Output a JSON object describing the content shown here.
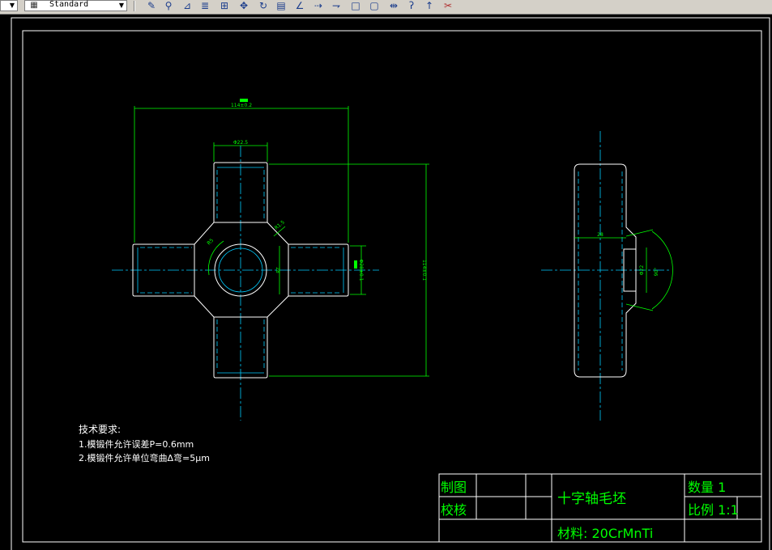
{
  "toolbar": {
    "style_select": "Standard",
    "icons": [
      "edit-icon",
      "pick-icon",
      "text-align-icon",
      "stack-icon",
      "grid-icon",
      "move-icon",
      "rotate-icon",
      "table-icon",
      "angle-icon",
      "line-dash-icon",
      "line-arrow-icon",
      "rectangle-icon",
      "square-icon",
      "dimension-icon",
      "question-icon",
      "help-icon",
      "tools-icon"
    ]
  },
  "drawing": {
    "dims": {
      "overall_width": "114±0.2",
      "top_arm_width": "Φ22.5",
      "overall_height": "114±0.1",
      "r_center": "R5",
      "r_corner": "R1.5",
      "hub": "28",
      "right_dia": "Φ28±0.1",
      "side_width": "28",
      "side_dia": "Φ22",
      "side_angle": "90°"
    },
    "notes": {
      "heading": "技术要求:",
      "line1": "1.模锻件允许误差P=0.6mm",
      "line2": "2.模锻件允许单位弯曲Δ弯=5μm"
    },
    "title_block": {
      "draw_label": "制图",
      "check_label": "校核",
      "part_name": "十字轴毛坯",
      "qty_label": "数量 1",
      "scale_label": "比例 1:1",
      "material_label": "材料: 20CrMnTi"
    },
    "colors": {
      "outline": "#ffffff",
      "dimension": "#00ff00",
      "centerline": "#00ccff",
      "title_text": "#00ff00"
    }
  }
}
